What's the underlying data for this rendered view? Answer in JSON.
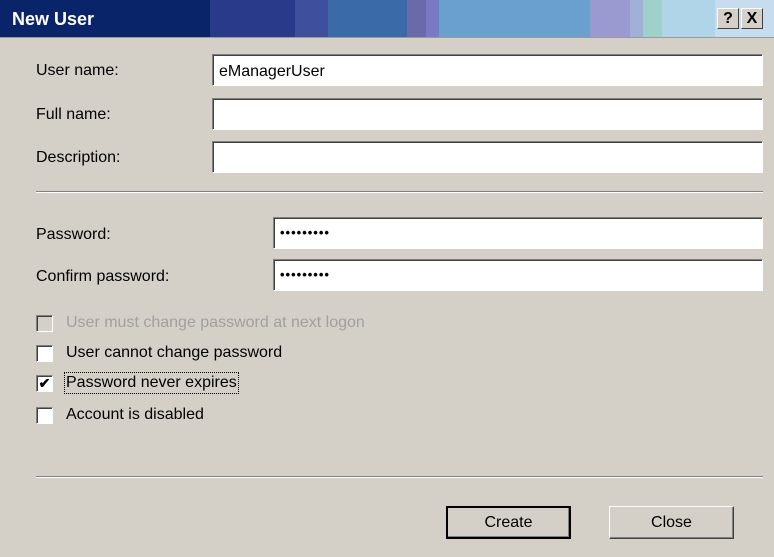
{
  "window": {
    "title": "New User",
    "help_label": "?",
    "close_label": "X",
    "title_colors": [
      "#0a246a",
      "#0a246a",
      "#2a3a8a",
      "#3e4f9e",
      "#3a6aa8",
      "#3a6aa8",
      "#6a6aaa",
      "#7a7ac4",
      "#6aa0d0",
      "#6aa0d0",
      "#9a9ad0",
      "#a0b0d8",
      "#a0d0cc",
      "#b0d4e8",
      "#c8dcf0"
    ]
  },
  "form": {
    "username_label": "User name:",
    "username_value": "eManagerUser",
    "fullname_label": "Full name:",
    "fullname_value": "",
    "description_label": "Description:",
    "description_value": "",
    "password_label": "Password:",
    "password_value": "•••••••••",
    "confirm_label": "Confirm password:",
    "confirm_value": "•••••••••"
  },
  "options": [
    {
      "label": "User must change password at next logon",
      "checked": false,
      "disabled": true
    },
    {
      "label": "User cannot change password",
      "checked": false,
      "disabled": false
    },
    {
      "label": "Password never expires",
      "checked": true,
      "disabled": false
    },
    {
      "label": "Account is disabled",
      "checked": false,
      "disabled": false
    }
  ],
  "buttons": {
    "create_label": "Create",
    "close_label": "Close"
  }
}
